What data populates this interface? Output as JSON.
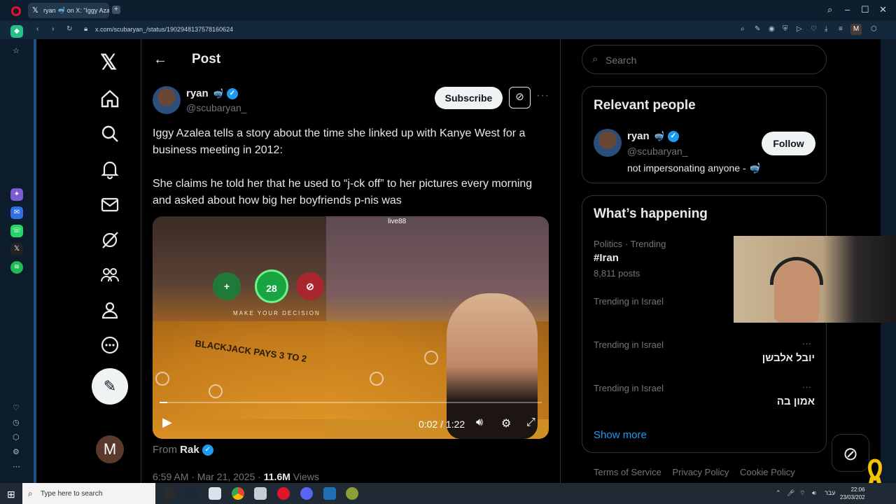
{
  "browser": {
    "tab_title": "ryan 🤿 on X: \"Iggy Azalea",
    "url": "x.com/scubaryan_/status/1902948137578160624"
  },
  "nav": {
    "items": [
      "home-icon",
      "explore-icon",
      "notifications-icon",
      "messages-icon",
      "grok-icon",
      "communities-icon",
      "profile-icon",
      "more-icon"
    ],
    "post_icon": "compose-icon",
    "account_initial": "M"
  },
  "post": {
    "header_title": "Post",
    "author_name": "ryan",
    "author_handle": "@scubaryan_",
    "subscribe_label": "Subscribe",
    "text_1": "Iggy Azalea tells a story about the time she linked up with Kanye West for a business meeting in 2012:",
    "text_2": "She claims he told her that he used to “j-ck off” to her pictures every morning and asked about how big her boyfriends p-nis was",
    "video": {
      "watermark": "live88",
      "decision_text": "MAKE YOUR DECISION",
      "chip_value": "28",
      "bj_text": "BLACKJACK PAYS 3 TO 2",
      "time": "0:02 / 1:22",
      "progress": 0.02
    },
    "from_label": "From",
    "from_name": "Rak",
    "meta_time": "6:59 AM · Mar 21, 2025 · ",
    "meta_views": "11.6M",
    "meta_views_label": " Views"
  },
  "sidebar": {
    "search_placeholder": "Search",
    "relevant": {
      "title": "Relevant people",
      "name": "ryan",
      "handle": "@scubaryan_",
      "bio": "not impersonating anyone - 🤿",
      "follow_label": "Follow"
    },
    "happening": {
      "title": "What’s happening",
      "trends": [
        {
          "meta": "Politics · Trending",
          "name": "#Iran",
          "count": "8,811 posts"
        },
        {
          "meta": "Trending in Israel",
          "name": "",
          "count": ""
        },
        {
          "meta": "Trending in Israel",
          "name": "יובל אלבשן",
          "count": ""
        },
        {
          "meta": "Trending in Israel",
          "name": "אמון בה",
          "count": ""
        }
      ],
      "show_more": "Show more"
    },
    "footer": [
      "Terms of Service",
      "Privacy Policy",
      "Cookie Policy"
    ]
  },
  "taskbar": {
    "search_placeholder": "Type here to search",
    "time": "22:06",
    "date": "23/03/202",
    "lang": "עבר"
  },
  "colors": {
    "accent": "#1d9bf0",
    "background": "#000000",
    "text": "#e7e9ea",
    "muted": "#71767b"
  }
}
